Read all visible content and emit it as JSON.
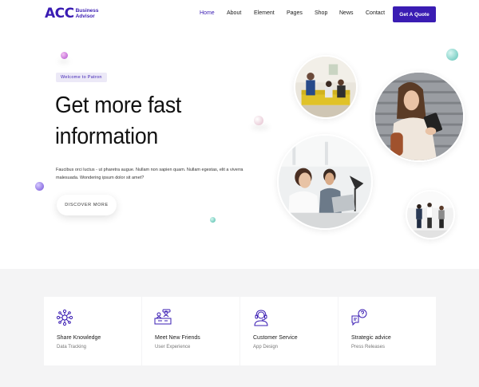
{
  "brand": {
    "mark": "ACC",
    "line1": "Business",
    "line2": "Advisor"
  },
  "nav": {
    "items": [
      {
        "label": "Home",
        "active": true
      },
      {
        "label": "About",
        "active": false
      },
      {
        "label": "Element",
        "active": false
      },
      {
        "label": "Pages",
        "active": false
      },
      {
        "label": "Shop",
        "active": false
      },
      {
        "label": "News",
        "active": false
      },
      {
        "label": "Contact",
        "active": false
      }
    ],
    "cta": "Get A Quote"
  },
  "hero": {
    "badge": "Welcome to Patron",
    "title_line1": "Get more fast",
    "title_line2": "information",
    "text": "Faucibus orci luctus - ut pharetra augue. Nullam non sapien quam. Nullam egestas, elit a viverra malesuada. Wondering ipsum dolor sit amet?",
    "button": "DISCOVER MORE"
  },
  "features": [
    {
      "title": "Share Knowledge",
      "subtitle": "Data Tracking",
      "icon": "network-icon"
    },
    {
      "title": "Meet New Friends",
      "subtitle": "User Experience",
      "icon": "meeting-icon"
    },
    {
      "title": "Customer Service",
      "subtitle": "App Design",
      "icon": "headset-icon"
    },
    {
      "title": "Strategic advice",
      "subtitle": "Press Releases",
      "icon": "chat-question-icon"
    }
  ],
  "colors": {
    "accent": "#3a1cb3",
    "feature_bg": "#f4f4f5",
    "badge_bg": "#ece9f7"
  }
}
